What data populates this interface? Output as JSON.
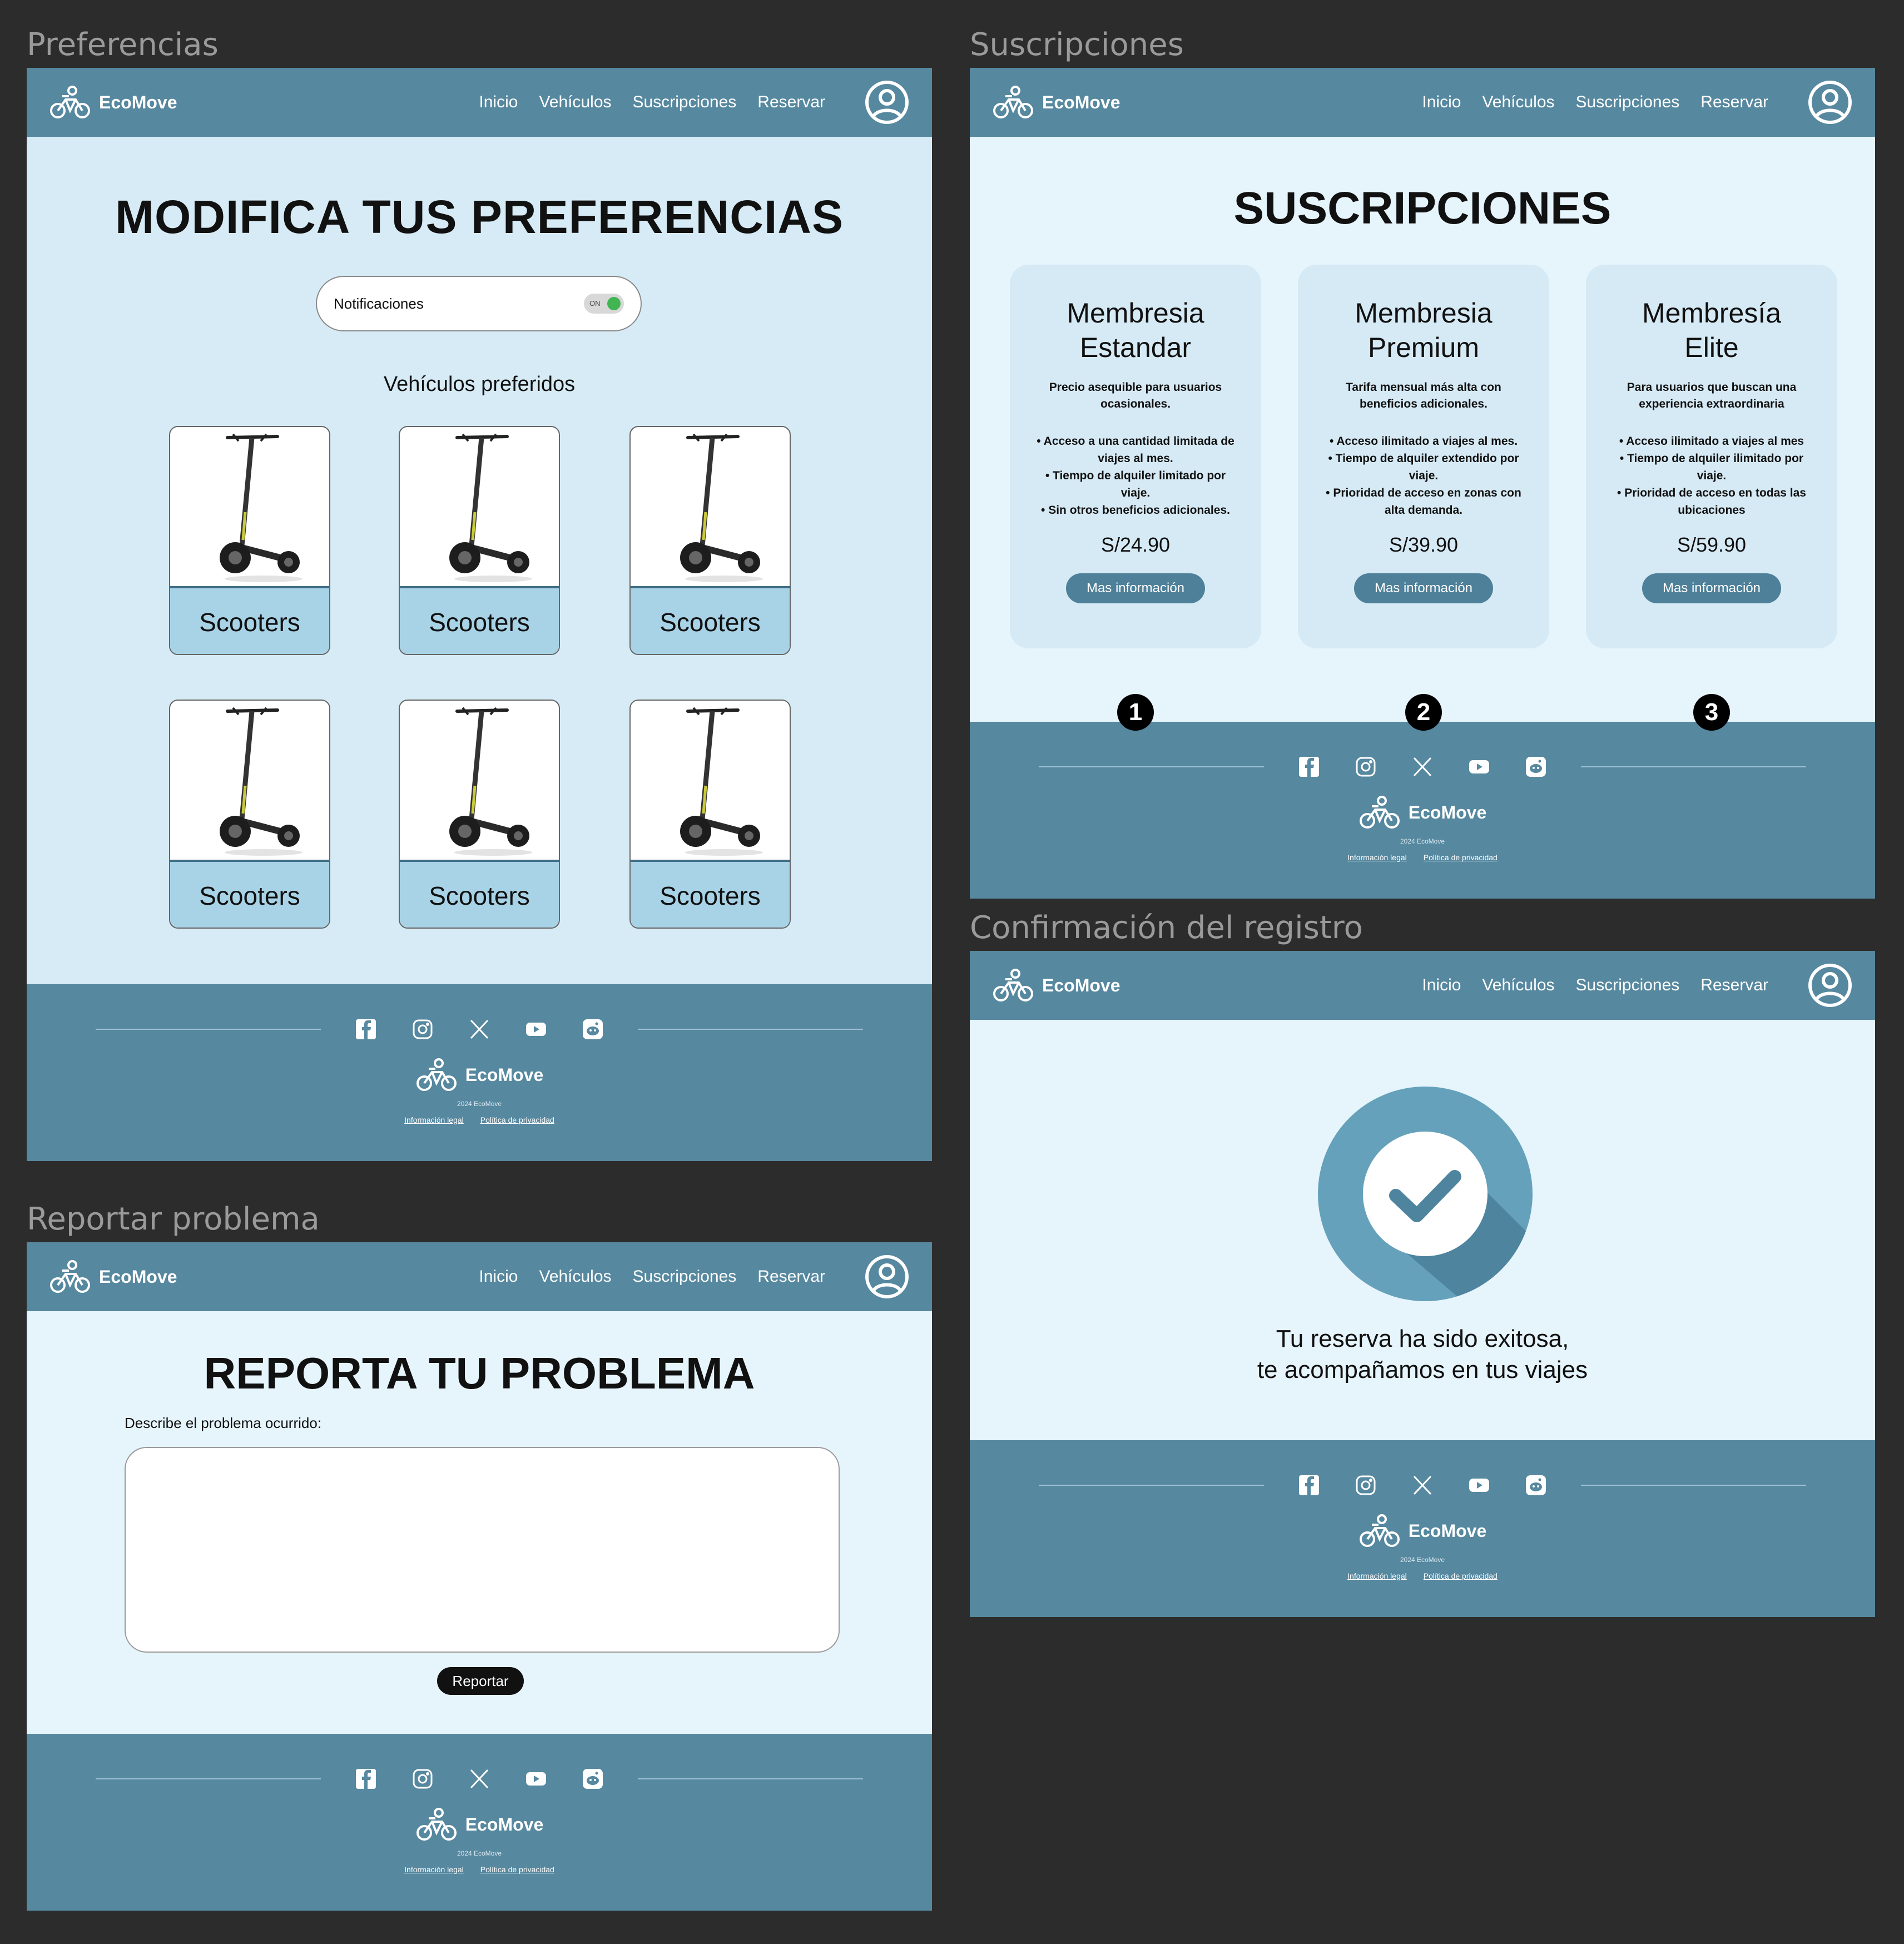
{
  "brand": {
    "name": "EcoMove",
    "copyright": "2024 EcoMove"
  },
  "nav": {
    "inicio": "Inicio",
    "vehiculos": "Vehículos",
    "suscripciones": "Suscripciones",
    "reservar": "Reservar"
  },
  "footer": {
    "legal": "Información legal",
    "privacy": "Política de privacidad"
  },
  "frames": {
    "preferencias": "Preferencias",
    "suscripciones": "Suscripciones",
    "confirmacion": "Confirmación del registro",
    "reportar": "Reportar problema"
  },
  "preferencias": {
    "title": "MODIFICA TUS PREFERENCIAS",
    "notifications_label": "Notificaciones",
    "toggle_state": "ON",
    "vehicles_title": "Vehículos preferidos",
    "vehicles": [
      "Scooters",
      "Scooters",
      "Scooters",
      "Scooters",
      "Scooters",
      "Scooters"
    ]
  },
  "reportar": {
    "title": "REPORTA TU PROBLEMA",
    "label": "Describe el problema ocurrido:",
    "textarea_value": "",
    "button": "Reportar"
  },
  "suscripciones": {
    "title": "SUSCRIPCIONES",
    "plans": [
      {
        "name_line1": "Membresia",
        "name_line2": "Estandar",
        "description": "Precio asequible para usuarios ocasionales.",
        "features": [
          "Acceso a una cantidad limitada de viajes al mes.",
          "Tiempo de alquiler limitado por viaje.",
          "Sin otros beneficios adicionales."
        ],
        "price": "S/24.90",
        "button": "Mas información",
        "number": "1"
      },
      {
        "name_line1": "Membresia",
        "name_line2": "Premium",
        "description": "Tarifa mensual más alta con beneficios adicionales.",
        "features": [
          "Acceso ilimitado a viajes al mes.",
          "Tiempo de alquiler extendido por viaje.",
          "Prioridad de acceso en zonas con alta demanda."
        ],
        "price": "S/39.90",
        "button": "Mas información",
        "number": "2"
      },
      {
        "name_line1": "Membresía",
        "name_line2": "Elite",
        "description": "Para usuarios que buscan una experiencia extraordinaria",
        "features": [
          "Acceso ilimitado a viajes al mes",
          "Tiempo de alquiler ilimitado por viaje.",
          "Prioridad de acceso en todas las ubicaciones"
        ],
        "price": "S/59.90",
        "button": "Mas información",
        "number": "3"
      }
    ]
  },
  "confirmacion": {
    "line1": "Tu reserva ha sido exitosa,",
    "line2": "te acompañamos en tus viajes"
  },
  "icons": {
    "logo": "bike-logo-icon",
    "user": "user-circle-icon",
    "socials": [
      "facebook-icon",
      "instagram-icon",
      "x-icon",
      "youtube-icon",
      "reddit-icon"
    ],
    "check": "check-circle-icon",
    "vehicle": "scooter-icon"
  },
  "colors": {
    "header": "#56889f",
    "page_bg": "#e6f4fc",
    "pref_bg": "#d6ebf5",
    "card_label": "#a8d3e7",
    "accent_button": "#4e8099",
    "toggle_on": "#41b552",
    "canvas": "#2c2c2c"
  }
}
